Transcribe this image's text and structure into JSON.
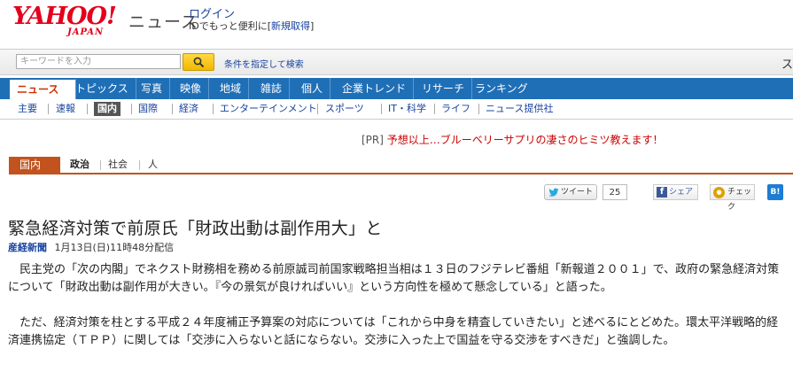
{
  "header": {
    "logo_text": "YAHOO!",
    "logo_sub": "JAPAN",
    "site_name": "ニュース",
    "login_label": "ログイン",
    "login_sub_prefix": "IDでもっと便利に[",
    "register_label": "新規取得",
    "login_sub_suffix": "]"
  },
  "search": {
    "placeholder": "キーワードを入力",
    "advanced_label": "条件を指定して検索",
    "right_char": "ス"
  },
  "main_nav": {
    "items": [
      "ニュース",
      "トピックス",
      "写真",
      "映像",
      "地域",
      "雑誌",
      "個人",
      "企業トレンド",
      "リサーチ",
      "ランキング"
    ]
  },
  "sub_nav": {
    "items": [
      "主要",
      "速報",
      "国内",
      "国際",
      "経済",
      "エンターテインメント",
      "スポーツ",
      "IT・科学",
      "ライフ",
      "ニュース提供社"
    ]
  },
  "pr": {
    "tag": "[PR]",
    "text": "予想以上…ブルーベリーサプリの凄さのヒミツ教えます！"
  },
  "category": {
    "active": "国内",
    "items": [
      "政治",
      "社会",
      "人"
    ]
  },
  "social": {
    "tweet_label": "ツイート",
    "tweet_count": "25",
    "facebook_label": "シェア",
    "check_label": "チェック",
    "hatena_label": "B!"
  },
  "article": {
    "title": "緊急経済対策で前原氏「財政出動は副作用大」と",
    "source": "産経新聞",
    "date": "1月13日(日)11時48分配信",
    "paragraph1": "民主党の「次の内閣」でネクスト財務相を務める前原誠司前国家戦略担当相は１３日のフジテレビ番組「新報道２００１」で、政府の緊急経済対策について「財政出動は副作用が大きい。『今の景気が良ければいい』という方向性を極めて懸念している」と語った。",
    "paragraph2": "ただ、経済対策を柱とする平成２４年度補正予算案の対応については「これから中身を精査していきたい」と述べるにとどめた。環太平洋戦略的経済連携協定（ＴＰＰ）に関しては「交渉に入らないと話にならない。交渉に入った上で国益を守る交渉をすべきだ」と強調した。"
  },
  "colors": {
    "brand_red": "#e4001b",
    "nav_blue": "#1f6fb7",
    "category_orange": "#c2531e",
    "link_blue": "#1a44a0"
  }
}
